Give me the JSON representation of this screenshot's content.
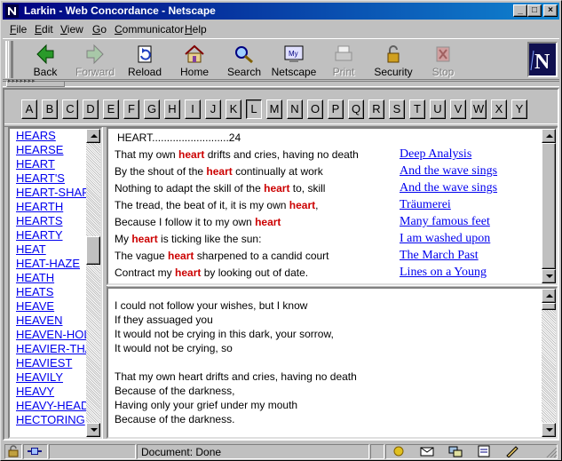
{
  "window": {
    "title": "Larkin - Web Concordance - Netscape"
  },
  "menu": [
    {
      "key": "F",
      "rest": "ile"
    },
    {
      "key": "E",
      "rest": "dit"
    },
    {
      "key": "V",
      "rest": "iew"
    },
    {
      "key": "G",
      "rest": "o"
    },
    {
      "key": "C",
      "rest": "ommunicator"
    },
    {
      "key": "H",
      "rest": "elp"
    }
  ],
  "toolbar": {
    "back": "Back",
    "forward": "Forward",
    "reload": "Reload",
    "home": "Home",
    "search": "Search",
    "netscape": "Netscape",
    "print": "Print",
    "security": "Security",
    "stop": "Stop"
  },
  "alphabet": [
    "A",
    "B",
    "C",
    "D",
    "E",
    "F",
    "G",
    "H",
    "I",
    "J",
    "K",
    "L",
    "M",
    "N",
    "O",
    "P",
    "Q",
    "R",
    "S",
    "T",
    "U",
    "V",
    "W",
    "X",
    "Y"
  ],
  "selected_letter": "L",
  "word_list": [
    "HEARS",
    "HEARSE",
    "HEART",
    "HEART'S",
    "HEART-SHAPED",
    "HEARTH",
    "HEARTS",
    "HEARTY",
    "HEAT",
    "HEAT-HAZE",
    "HEATH",
    "HEATS",
    "HEAVE",
    "HEAVEN",
    "HEAVEN-HOLDING",
    "HEAVIER-THAN-AIR",
    "HEAVIEST",
    "HEAVILY",
    "HEAVY",
    "HEAVY-HEADED",
    "HECTORING"
  ],
  "concordance": {
    "heading": "HEART..........................24",
    "lines": [
      {
        "before": "That my own ",
        "keyword": "heart",
        "after": " drifts and cries, having no death",
        "poem": "Deep Analysis"
      },
      {
        "before": "By the shout of the ",
        "keyword": "heart",
        "after": " continually at work",
        "poem": "And the wave sings"
      },
      {
        "before": "Nothing to adapt the skill of the ",
        "keyword": "heart",
        "after": " to, skill",
        "poem": "And the wave sings"
      },
      {
        "before": "The tread, the beat of it, it is my own ",
        "keyword": "heart",
        "after": ",",
        "poem": "Träumerei"
      },
      {
        "before": "Because I follow it to my own ",
        "keyword": "heart",
        "after": "",
        "poem": "Many famous feet"
      },
      {
        "before": "My ",
        "keyword": "heart",
        "after": " is ticking like the sun:",
        "poem": "I am washed upon"
      },
      {
        "before": "The vague ",
        "keyword": "heart",
        "after": " sharpened to a candid court",
        "poem": "The March Past"
      },
      {
        "before": "Contract my ",
        "keyword": "heart",
        "after": " by looking out of date.",
        "poem": "Lines on a Young"
      }
    ]
  },
  "poem_text": [
    "I could not follow your wishes, but I know",
    "If they assuaged you",
    "It would not be crying in this dark, your sorrow,",
    "It would not be crying, so",
    "",
    "That my own heart drifts and cries, having no death",
    "Because of the darkness,",
    "Having only your grief under my mouth",
    "Because of the darkness."
  ],
  "status": {
    "text": "Document: Done"
  },
  "colors": {
    "title_bar": "#000080",
    "link": "#0000ee",
    "keyword": "#cc0000"
  }
}
